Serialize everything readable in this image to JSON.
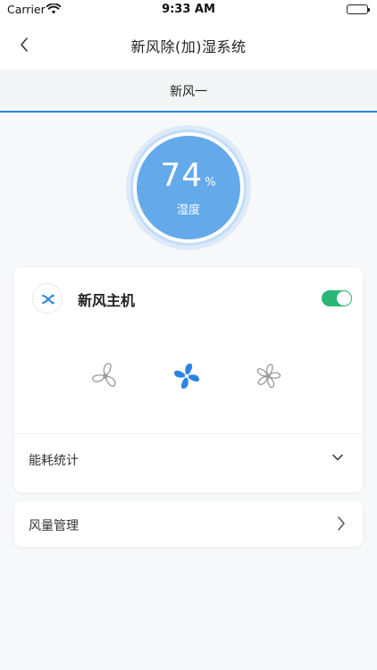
{
  "status_bar": {
    "carrier": "Carrier",
    "time": "9:33 AM",
    "icons": [
      "wifi-icon",
      "battery-icon"
    ]
  },
  "header": {
    "title": "新风除(加)湿系统",
    "back_icon": "chevron-left-icon"
  },
  "tabs": [
    {
      "label": "新风一",
      "active": true
    }
  ],
  "humidity": {
    "value": "74",
    "unit": "%",
    "label": "湿度"
  },
  "device": {
    "name": "新风主机",
    "icon": "fan-cross-icon",
    "power_on": true,
    "fan_speeds": [
      {
        "name": "low",
        "icon": "fan-low-icon",
        "selected": false
      },
      {
        "name": "mid",
        "icon": "fan-mid-icon",
        "selected": true
      },
      {
        "name": "high",
        "icon": "fan-high-icon",
        "selected": false
      }
    ],
    "energy_label": "能耗统计"
  },
  "air_volume": {
    "label": "风量管理"
  },
  "colors": {
    "accent": "#2a84e6",
    "gauge_core": "#64aaea",
    "toggle_on": "#2bb673",
    "fan_selected": "#2a84e6",
    "fan_unselected": "#999999"
  }
}
